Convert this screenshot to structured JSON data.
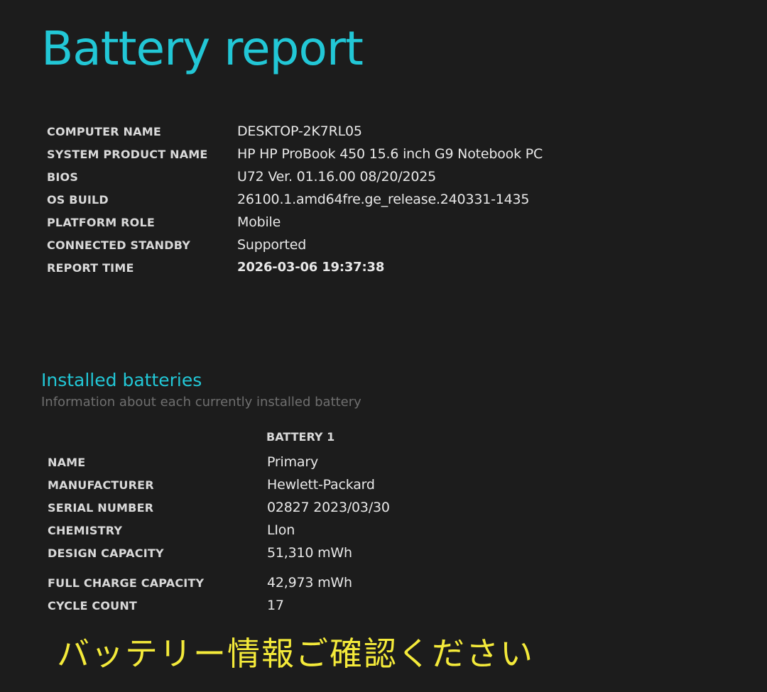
{
  "report": {
    "title": "Battery report"
  },
  "system_info": [
    {
      "label": "COMPUTER NAME",
      "value": "DESKTOP-2K7RL05"
    },
    {
      "label": "SYSTEM PRODUCT NAME",
      "value": "HP HP ProBook 450 15.6 inch G9 Notebook PC"
    },
    {
      "label": "BIOS",
      "value": "U72 Ver. 01.16.00 08/20/2025"
    },
    {
      "label": "OS BUILD",
      "value": "26100.1.amd64fre.ge_release.240331-1435"
    },
    {
      "label": "PLATFORM ROLE",
      "value": "Mobile"
    },
    {
      "label": "CONNECTED STANDBY",
      "value": "Supported"
    },
    {
      "label": "REPORT TIME",
      "value": "2026-03-06  19:37:38"
    }
  ],
  "installed_batteries": {
    "title": "Installed batteries",
    "subtitle": "Information about each currently installed battery",
    "column_header": "BATTERY 1",
    "rows": [
      {
        "label": "NAME",
        "value": "Primary"
      },
      {
        "label": "MANUFACTURER",
        "value": "Hewlett-Packard"
      },
      {
        "label": "SERIAL NUMBER",
        "value": "02827 2023/03/30"
      },
      {
        "label": "CHEMISTRY",
        "value": "LIon"
      },
      {
        "label": "DESIGN CAPACITY",
        "value": "51,310 mWh"
      },
      {
        "label": "FULL CHARGE CAPACITY",
        "value": "42,973 mWh"
      },
      {
        "label": "CYCLE COUNT",
        "value": "17"
      }
    ]
  },
  "footer_note": "バッテリー情報ご確認ください",
  "colors": {
    "background": "#1c1c1c",
    "accent": "#22c7d6",
    "label": "#d9d9d9",
    "value": "#e8e8e8",
    "subtitle": "#6f6f6f",
    "note": "#f4ea3a"
  }
}
